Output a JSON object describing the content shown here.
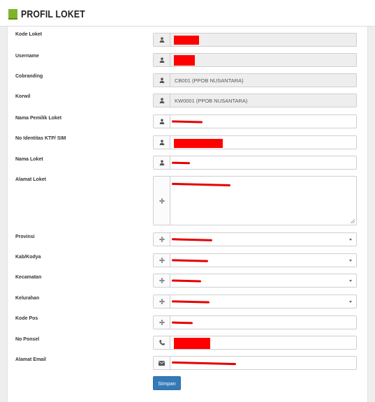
{
  "header": {
    "title": "PROFIL LOKET"
  },
  "form": {
    "fields": [
      {
        "label": "Kode Loket",
        "value": "",
        "icon": "user-icon",
        "readonly": true,
        "redacted": "box"
      },
      {
        "label": "Username",
        "value": "",
        "icon": "user-icon",
        "readonly": true,
        "redacted": "box"
      },
      {
        "label": "Cobranding",
        "value": "CB001 (PPOB NUSANTARA)",
        "icon": "user-icon",
        "readonly": true
      },
      {
        "label": "Korwil",
        "value": "KW0001 (PPOB NUSANTARA)",
        "icon": "user-icon",
        "readonly": true
      },
      {
        "label": "Nama Pemilik Loket",
        "value": "",
        "icon": "user-icon",
        "redacted": "line"
      },
      {
        "label": "No Identitas KTP/ SIM",
        "value": "",
        "icon": "user-icon",
        "redacted": "box"
      },
      {
        "label": "Nama Loket",
        "value": "",
        "icon": "user-icon",
        "redacted": "line"
      },
      {
        "label": "Alamat Loket",
        "value": "",
        "icon": "move-icon",
        "redacted": "line",
        "textarea": true
      },
      {
        "label": "Provinsi",
        "value": "",
        "icon": "move-icon",
        "redacted": "line",
        "select": true
      },
      {
        "label": "Kab/Kodya",
        "value": "",
        "icon": "move-icon",
        "redacted": "line",
        "select": true
      },
      {
        "label": "Kecamatan",
        "value": "",
        "icon": "move-icon",
        "redacted": "line",
        "select": true
      },
      {
        "label": "Kelurahan",
        "value": "",
        "icon": "move-icon",
        "redacted": "line",
        "select": true
      },
      {
        "label": "Kode Pos",
        "value": "",
        "icon": "move-icon",
        "redacted": "line"
      },
      {
        "label": "No Ponsel",
        "value": "",
        "icon": "phone-icon",
        "redacted": "box"
      },
      {
        "label": "Alamat Email",
        "value": "",
        "icon": "envelope-icon",
        "redacted": "line"
      }
    ],
    "submit_label": "Simpan"
  },
  "colors": {
    "accent": "#7fb42a",
    "button": "#337ab7",
    "redaction": "#ff0000"
  }
}
